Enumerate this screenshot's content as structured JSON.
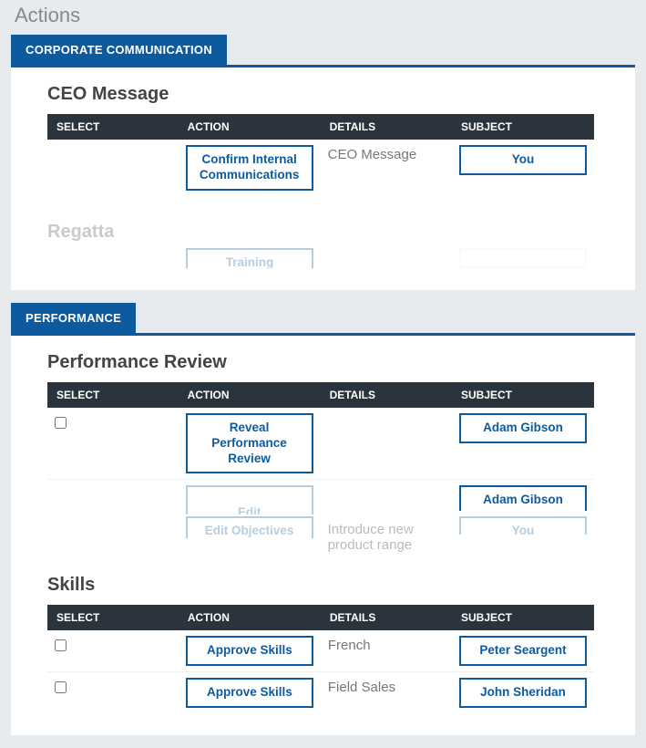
{
  "page": {
    "title": "Actions"
  },
  "columns": {
    "select": "SELECT",
    "action": "ACTION",
    "details": "DETAILS",
    "subject": "SUBJECT"
  },
  "corporate": {
    "tab": "CORPORATE COMMUNICATION",
    "heading": "CEO Message",
    "row1": {
      "action": "Confirm Internal Communications",
      "details": "CEO Message",
      "subject": "You"
    },
    "ghost_heading": "Regatta",
    "ghost_row": {
      "action": "Training"
    }
  },
  "performance": {
    "tab": "PERFORMANCE",
    "heading1": "Performance Review",
    "pr_row1": {
      "action": "Reveal Performance Review",
      "subject": "Adam Gibson"
    },
    "pr_row2": {
      "action": "Edit",
      "subject": "Adam Gibson"
    },
    "pr_row3": {
      "action": "Edit Objectives",
      "details": "Introduce new product range",
      "subject": "You"
    },
    "heading2": "Skills",
    "sk_row1": {
      "action": "Approve Skills",
      "details": "French",
      "subject": "Peter Seargent"
    },
    "sk_row2": {
      "action": "Approve Skills",
      "details": "Field Sales",
      "subject": "John Sheridan"
    }
  }
}
